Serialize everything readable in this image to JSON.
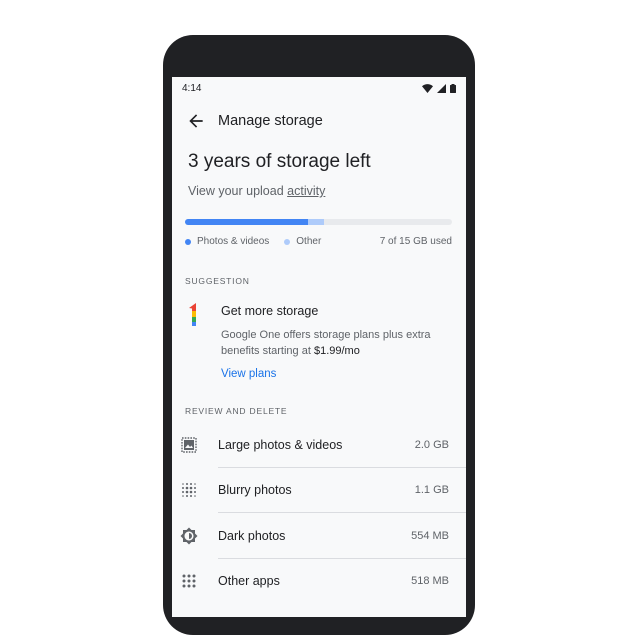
{
  "status_bar": {
    "time": "4:14",
    "icons": [
      "wifi-icon",
      "signal-icon",
      "battery-icon"
    ]
  },
  "app_bar": {
    "title": "Manage storage",
    "back_icon": "arrow-back-icon"
  },
  "storage": {
    "headline": "3 years of storage left",
    "subtitle_prefix": "View your upload ",
    "subtitle_link": "activity",
    "used_fraction_photos": 0.46,
    "used_fraction_other": 0.06,
    "legend": [
      {
        "label": "Photos & videos",
        "color": "#4285f4"
      },
      {
        "label": "Other",
        "color": "#aecbfa"
      }
    ],
    "used_text": "7 of 15 GB used"
  },
  "suggestion": {
    "section_label": "SUGGESTION",
    "title": "Get more storage",
    "description_prefix": "Google One offers storage plans plus extra benefits starting at ",
    "price": "$1.99/mo",
    "link": "View plans"
  },
  "review": {
    "section_label": "REVIEW AND DELETE",
    "items": [
      {
        "label": "Large photos & videos",
        "size": "2.0 GB",
        "icon": "large-photo-icon"
      },
      {
        "label": "Blurry photos",
        "size": "1.1 GB",
        "icon": "blurry-icon"
      },
      {
        "label": "Dark photos",
        "size": "554 MB",
        "icon": "dark-photo-icon"
      },
      {
        "label": "Other apps",
        "size": "518 MB",
        "icon": "apps-icon"
      }
    ]
  },
  "colors": {
    "accent": "#1a73e8",
    "photos": "#4285f4",
    "other": "#aecbfa",
    "device_frame": "#202124"
  }
}
